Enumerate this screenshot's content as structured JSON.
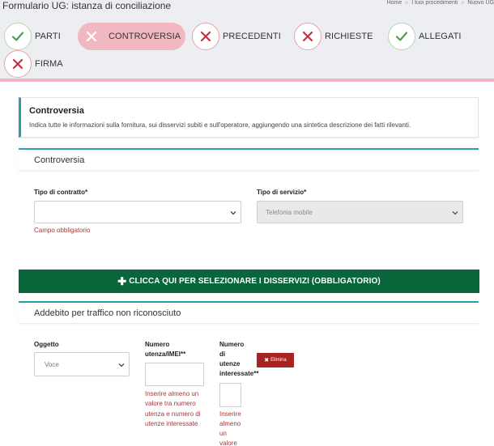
{
  "app": {
    "title": "Formulario UG: istanza di conciliazione"
  },
  "breadcrumb": [
    "Home",
    "I tuoi procedimenti",
    "Nuovo UG"
  ],
  "steps": [
    {
      "label": "PARTI",
      "status": "ok"
    },
    {
      "label": "CONTROVERSIA",
      "status": "active"
    },
    {
      "label": "PRECEDENTI",
      "status": "error"
    },
    {
      "label": "RICHIESTE",
      "status": "error"
    },
    {
      "label": "ALLEGATI",
      "status": "ok"
    },
    {
      "label": "FIRMA",
      "status": "error"
    }
  ],
  "info": {
    "title": "Controversia",
    "text": "Indica tutte le informazioni sulla fornitura, sui disservizi subiti e sull'operatore, aggiungendo una sintetica descrizione dei fatti rilevanti."
  },
  "controversia": {
    "section_title": "Controversia",
    "tipo_contratto": {
      "label": "Tipo di contratto*",
      "value": "",
      "error": "Campo obbligatorio"
    },
    "tipo_servizio": {
      "label": "Tipo di servizio*",
      "value": "Telefonia mobile"
    }
  },
  "disservizi_button": "CLICCA QUI PER SELEZIONARE I DISSERVIZI (OBBLIGATORIO)",
  "addebito": {
    "section_title": "Addebito per traffico non riconosciuto",
    "oggetto": {
      "label": "Oggetto",
      "value": "Voce"
    },
    "numero_utenza": {
      "label_line1": "Numero",
      "label_line2": "utenza/IMEI**",
      "value": "",
      "error_lines": [
        "Inserire almeno un",
        "valore tra numero",
        "utenza e numero di",
        "utenze interessate"
      ]
    },
    "numero_utenze": {
      "label_lines": [
        "Numero",
        "di",
        "utenze",
        "interessate**"
      ],
      "value": "",
      "error_lines": [
        "Inserire",
        "almeno",
        "un",
        "valore"
      ]
    },
    "delete_label": "Elimina"
  },
  "colors": {
    "teal": "#2a9fa8",
    "green_button": "#08663a",
    "error_red": "#a23b3b",
    "active_pink": "#f2b8c1",
    "delete_red": "#a8231f"
  }
}
